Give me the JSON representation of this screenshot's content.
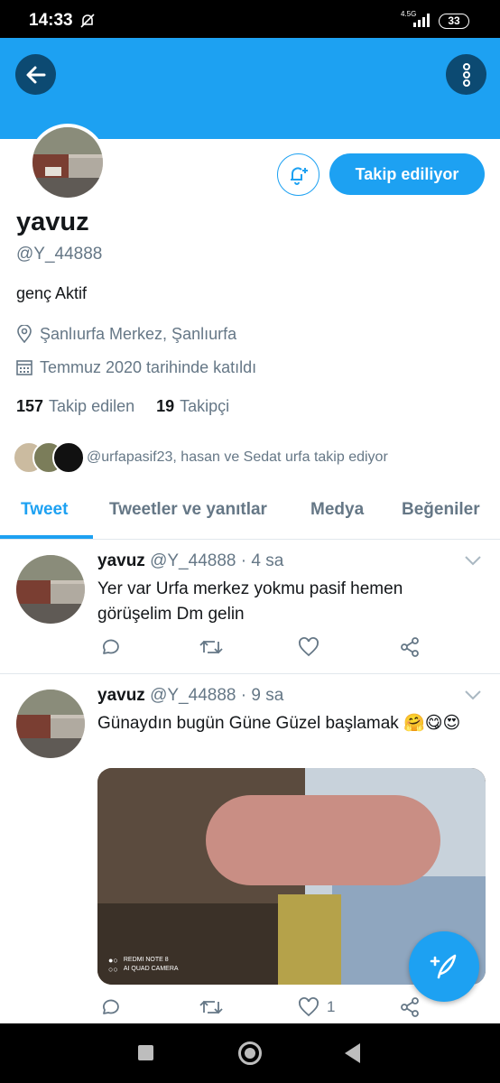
{
  "status_bar": {
    "time": "14:33",
    "network": "4.5G",
    "battery": "33"
  },
  "profile": {
    "display_name": "yavuz",
    "handle": "@Y_44888",
    "bio": "genç Aktif",
    "location": "Şanlıurfa Merkez, Şanlıurfa",
    "joined": "Temmuz 2020 tarihinde katıldı",
    "following_count": "157",
    "following_label": "Takip edilen",
    "followers_count": "19",
    "followers_label": "Takipçi",
    "known_followers": "@urfapasif23, hasan ve Sedat urfa takip ediyor",
    "follow_button_label": "Takip ediliyor"
  },
  "tabs": [
    {
      "label": "Tweet",
      "active": true
    },
    {
      "label": "Tweetler ve yanıtlar",
      "active": false
    },
    {
      "label": "Medya",
      "active": false
    },
    {
      "label": "Beğeniler",
      "active": false
    }
  ],
  "tweets": [
    {
      "name": "yavuz",
      "handle": "@Y_44888",
      "time": "· 4 sa",
      "text": "Yer var Urfa merkez yokmu pasif hemen görüşelim Dm gelin",
      "likes": ""
    },
    {
      "name": "yavuz",
      "handle": "@Y_44888",
      "time": "· 9 sa",
      "text": "Günaydın bugün Güne Güzel başlamak 🤗😋😍",
      "likes": "1",
      "media_watermark_line1": "REDMI NOTE 8",
      "media_watermark_line2": "AI QUAD CAMERA"
    }
  ],
  "colors": {
    "accent": "#1da1f2",
    "text": "#14171a",
    "secondary": "#657786",
    "banner_button": "#0c4a72"
  },
  "icons": [
    "arrow-back-icon",
    "more-vertical-icon",
    "bell-plus-icon",
    "location-icon",
    "calendar-icon",
    "chevron-down-icon",
    "reply-icon",
    "retweet-icon",
    "like-icon",
    "share-icon",
    "compose-icon"
  ]
}
